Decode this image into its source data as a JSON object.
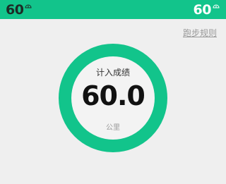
{
  "status_bar": {
    "left_value": "60",
    "right_value": "60",
    "left_icon": "battery-icon",
    "right_icon": "battery-icon",
    "color": "#12c48b"
  },
  "header": {
    "rules_link": "跑步规则"
  },
  "result": {
    "title": "计入成绩",
    "value": "60.0",
    "unit": "公里",
    "ring_color": "#12c48b"
  }
}
